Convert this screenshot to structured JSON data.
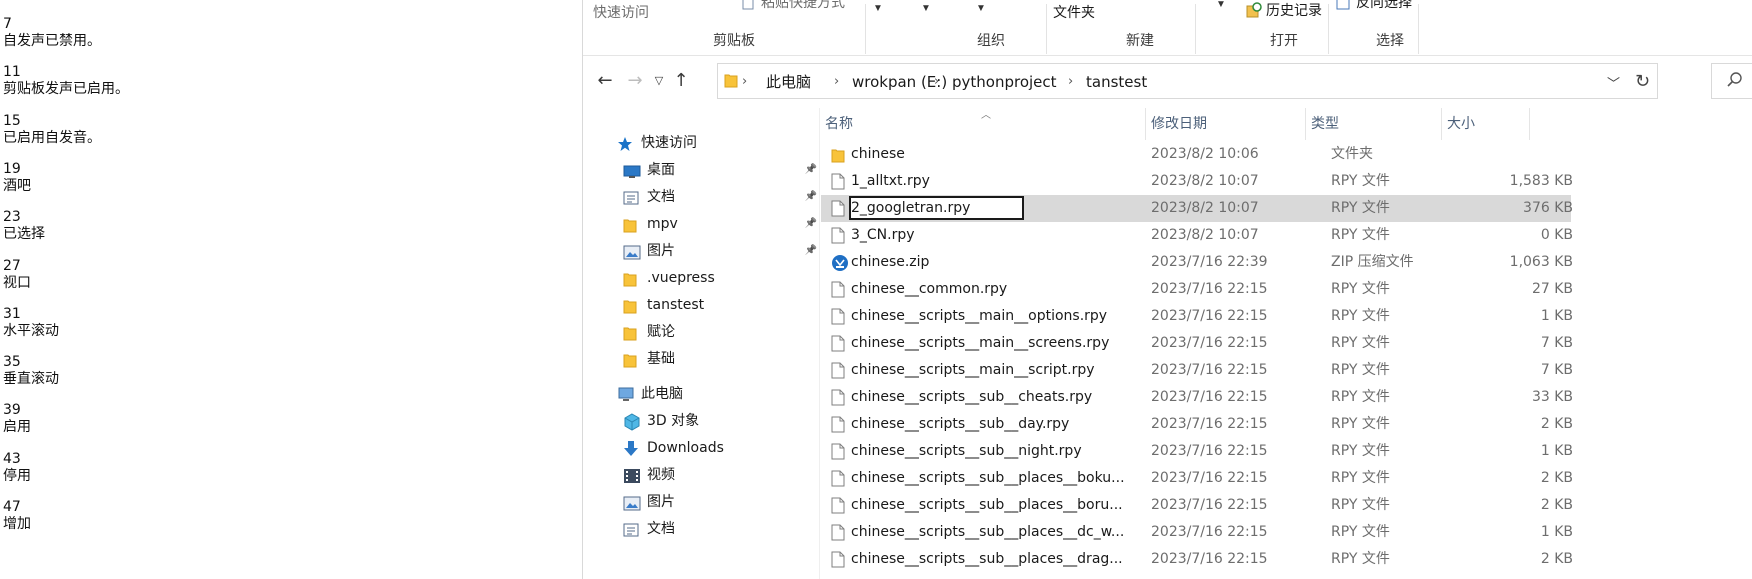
{
  "text_entries": [
    {
      "num": "7",
      "text": "自发声已禁用。"
    },
    {
      "num": "11",
      "text": "剪贴板发声已启用。"
    },
    {
      "num": "15",
      "text": "已启用自发音。"
    },
    {
      "num": "19",
      "text": "酒吧"
    },
    {
      "num": "23",
      "text": "已选择"
    },
    {
      "num": "27",
      "text": "视口"
    },
    {
      "num": "31",
      "text": "水平滚动"
    },
    {
      "num": "35",
      "text": "垂直滚动"
    },
    {
      "num": "39",
      "text": "启用"
    },
    {
      "num": "43",
      "text": "停用"
    },
    {
      "num": "47",
      "text": "增加"
    }
  ],
  "ribbon": {
    "quick_access": "快速访问",
    "paste_shortcut": "粘贴快捷方式",
    "folder": "文件夹",
    "history": "历史记录",
    "invert_selection": "反向选择",
    "groups": {
      "clipboard": "剪贴板",
      "organize": "组织",
      "new": "新建",
      "open": "打开",
      "select": "选择"
    }
  },
  "address": {
    "crumbs": [
      "此电脑",
      "wrokpan (E:)",
      "pythonproject",
      "tanstest"
    ]
  },
  "nav_pane": {
    "items": [
      {
        "label": "快速访问",
        "icon": "star-icon",
        "pinned": false
      },
      {
        "label": "桌面",
        "icon": "desktop-icon",
        "pinned": true
      },
      {
        "label": "文档",
        "icon": "document-icon",
        "pinned": true
      },
      {
        "label": "mpv",
        "icon": "folder-icon",
        "pinned": true
      },
      {
        "label": "图片",
        "icon": "picture-icon",
        "pinned": true
      },
      {
        "label": ".vuepress",
        "icon": "folder-icon",
        "pinned": false
      },
      {
        "label": "tanstest",
        "icon": "folder-icon",
        "pinned": false
      },
      {
        "label": "赋论",
        "icon": "folder-icon",
        "pinned": false
      },
      {
        "label": "基础",
        "icon": "folder-icon",
        "pinned": false
      },
      {
        "label": "此电脑",
        "icon": "computer-icon",
        "pinned": false
      },
      {
        "label": "3D 对象",
        "icon": "cube-icon",
        "pinned": false
      },
      {
        "label": "Downloads",
        "icon": "download-icon",
        "pinned": false
      },
      {
        "label": "视频",
        "icon": "video-icon",
        "pinned": false
      },
      {
        "label": "图片",
        "icon": "picture-icon",
        "pinned": false
      },
      {
        "label": "文档",
        "icon": "document-icon",
        "pinned": false
      }
    ]
  },
  "file_list": {
    "columns": {
      "name": "名称",
      "date": "修改日期",
      "type": "类型",
      "size": "大小"
    },
    "rows": [
      {
        "name": "chinese",
        "date": "2023/8/2 10:06",
        "type": "文件夹",
        "size": "",
        "icon": "folder-icon",
        "selected": false
      },
      {
        "name": "1_alltxt.rpy",
        "date": "2023/8/2 10:07",
        "type": "RPY 文件",
        "size": "1,583 KB",
        "icon": "file-icon",
        "selected": false
      },
      {
        "name": "2_googletran.rpy",
        "date": "2023/8/2 10:07",
        "type": "RPY 文件",
        "size": "376 KB",
        "icon": "file-icon",
        "selected": true
      },
      {
        "name": "3_CN.rpy",
        "date": "2023/8/2 10:07",
        "type": "RPY 文件",
        "size": "0 KB",
        "icon": "file-icon",
        "selected": false
      },
      {
        "name": "chinese.zip",
        "date": "2023/7/16 22:39",
        "type": "ZIP 压缩文件",
        "size": "1,063 KB",
        "icon": "zip-icon",
        "selected": false
      },
      {
        "name": "chinese__common.rpy",
        "date": "2023/7/16 22:15",
        "type": "RPY 文件",
        "size": "27 KB",
        "icon": "file-icon",
        "selected": false
      },
      {
        "name": "chinese__scripts__main__options.rpy",
        "date": "2023/7/16 22:15",
        "type": "RPY 文件",
        "size": "1 KB",
        "icon": "file-icon",
        "selected": false
      },
      {
        "name": "chinese__scripts__main__screens.rpy",
        "date": "2023/7/16 22:15",
        "type": "RPY 文件",
        "size": "7 KB",
        "icon": "file-icon",
        "selected": false
      },
      {
        "name": "chinese__scripts__main__script.rpy",
        "date": "2023/7/16 22:15",
        "type": "RPY 文件",
        "size": "7 KB",
        "icon": "file-icon",
        "selected": false
      },
      {
        "name": "chinese__scripts__sub__cheats.rpy",
        "date": "2023/7/16 22:15",
        "type": "RPY 文件",
        "size": "33 KB",
        "icon": "file-icon",
        "selected": false
      },
      {
        "name": "chinese__scripts__sub__day.rpy",
        "date": "2023/7/16 22:15",
        "type": "RPY 文件",
        "size": "2 KB",
        "icon": "file-icon",
        "selected": false
      },
      {
        "name": "chinese__scripts__sub__night.rpy",
        "date": "2023/7/16 22:15",
        "type": "RPY 文件",
        "size": "1 KB",
        "icon": "file-icon",
        "selected": false
      },
      {
        "name": "chinese__scripts__sub__places__boku...",
        "date": "2023/7/16 22:15",
        "type": "RPY 文件",
        "size": "2 KB",
        "icon": "file-icon",
        "selected": false
      },
      {
        "name": "chinese__scripts__sub__places__boru...",
        "date": "2023/7/16 22:15",
        "type": "RPY 文件",
        "size": "2 KB",
        "icon": "file-icon",
        "selected": false
      },
      {
        "name": "chinese__scripts__sub__places__dc_w...",
        "date": "2023/7/16 22:15",
        "type": "RPY 文件",
        "size": "1 KB",
        "icon": "file-icon",
        "selected": false
      },
      {
        "name": "chinese__scripts__sub__places__drag...",
        "date": "2023/7/16 22:15",
        "type": "RPY 文件",
        "size": "2 KB",
        "icon": "file-icon",
        "selected": false
      }
    ]
  },
  "colors": {
    "selected_row": "#d9d9d9",
    "folder_yellow": "#f8c33a",
    "header_text": "#4c607a",
    "star_blue": "#1a73c8"
  }
}
